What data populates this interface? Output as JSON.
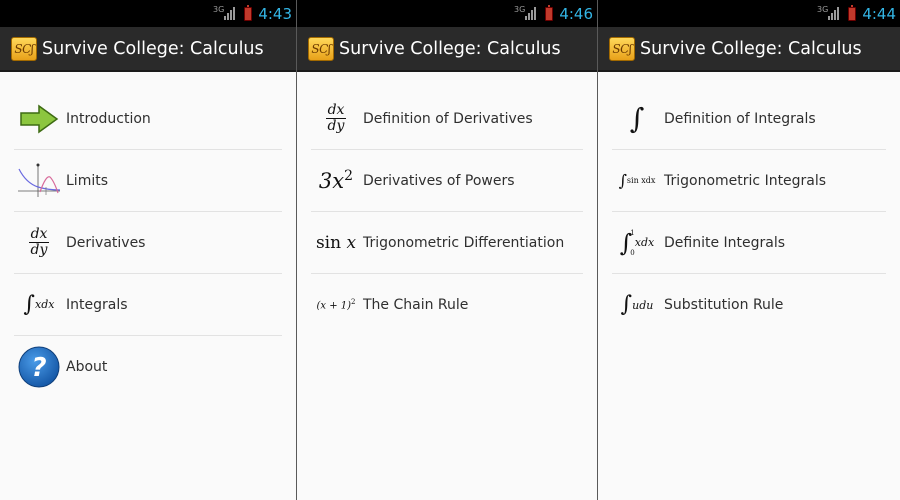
{
  "screens": [
    {
      "status": {
        "network": "3G",
        "time": "4:43"
      },
      "app": {
        "icon_text": "SCʃ",
        "title": "Survive College: Calculus"
      },
      "items": [
        {
          "icon": "arrow-right-icon",
          "label": "Introduction"
        },
        {
          "icon": "limits-graph-icon",
          "label": "Limits"
        },
        {
          "icon": "dx-dy-icon",
          "math_num": "dx",
          "math_den": "dy",
          "label": "Derivatives"
        },
        {
          "icon": "integral-xdx-icon",
          "math": "xdx",
          "label": "Integrals"
        },
        {
          "icon": "help-icon",
          "glyph": "?",
          "label": "About"
        }
      ]
    },
    {
      "status": {
        "network": "3G",
        "time": "4:46"
      },
      "app": {
        "icon_text": "SCʃ",
        "title": "Survive College: Calculus"
      },
      "items": [
        {
          "icon": "dx-dy-icon",
          "math_num": "dx",
          "math_den": "dy",
          "label": "Definition of Derivatives"
        },
        {
          "icon": "power-icon",
          "math_base": "3x",
          "math_exp": "2",
          "label": "Derivatives of Powers"
        },
        {
          "icon": "sin-x-icon",
          "math_fn": "sin",
          "math_var": "x",
          "label": "Trigonometric Differentiation"
        },
        {
          "icon": "chain-rule-icon",
          "math": "(x + 1)",
          "math_exp": "2",
          "label": "The Chain Rule"
        }
      ]
    },
    {
      "status": {
        "network": "3G",
        "time": "4:44"
      },
      "app": {
        "icon_text": "SCʃ",
        "title": "Survive College: Calculus"
      },
      "items": [
        {
          "icon": "integral-icon",
          "label": "Definition of Integrals"
        },
        {
          "icon": "integral-sin-icon",
          "math": "sin xdx",
          "label": "Trigonometric Integrals"
        },
        {
          "icon": "definite-integral-icon",
          "upper": "1",
          "lower": "0",
          "math": "xdx",
          "label": "Definite Integrals"
        },
        {
          "icon": "integral-udu-icon",
          "math": "udu",
          "label": "Substitution Rule"
        }
      ]
    }
  ],
  "colors": {
    "clock": "#33b5e5",
    "action_bar": "#2a2a2a",
    "arrow_fill": "#8cc63f",
    "help_blue": "#1f6fbf"
  }
}
